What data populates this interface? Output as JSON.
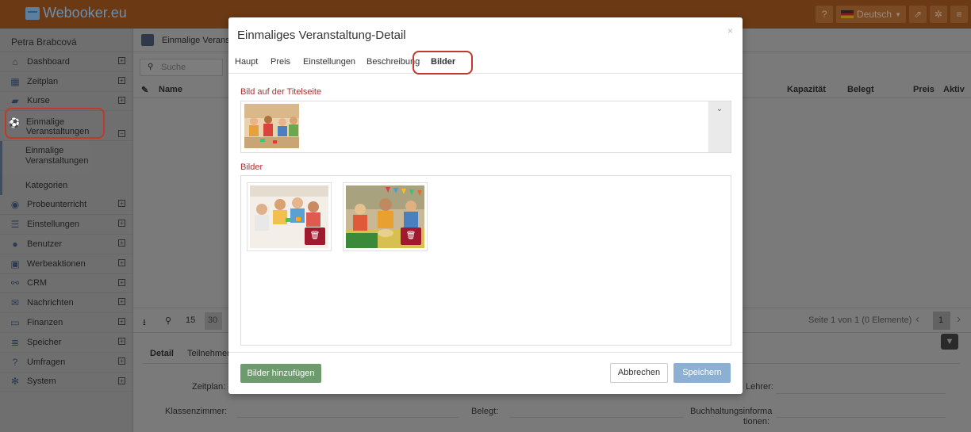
{
  "app": {
    "logo_text": "Webooker.eu"
  },
  "topbar": {
    "help_icon": "question-icon",
    "language": "Deutsch",
    "external_icon": "external-link-icon",
    "settings_icon": "gear-icon",
    "menu_icon": "hamburger-icon"
  },
  "sidebar": {
    "user": "Petra Brabcová",
    "items": [
      {
        "label": "Dashboard",
        "icon": "home-icon"
      },
      {
        "label": "Zeitplan",
        "icon": "calendar-icon"
      },
      {
        "label": "Kurse",
        "icon": "book-icon"
      },
      {
        "label": "Einmalige Veranstaltungen",
        "icon": "soccer-icon"
      },
      {
        "label": "Probeunterricht",
        "icon": "eye-slash-icon"
      },
      {
        "label": "Einstellungen",
        "icon": "sliders-icon"
      },
      {
        "label": "Benutzer",
        "icon": "users-icon"
      },
      {
        "label": "Werbeaktionen",
        "icon": "gift-icon"
      },
      {
        "label": "CRM",
        "icon": "handshake-icon"
      },
      {
        "label": "Nachrichten",
        "icon": "envelope-icon"
      },
      {
        "label": "Finanzen",
        "icon": "money-icon"
      },
      {
        "label": "Speicher",
        "icon": "database-icon"
      },
      {
        "label": "Umfragen",
        "icon": "question-icon"
      },
      {
        "label": "System",
        "icon": "cogs-icon"
      }
    ],
    "subitems": [
      "Einmalige Veranstaltungen",
      "Kategorien"
    ]
  },
  "main": {
    "breadcrumb": "Einmalige Veranst",
    "search_placeholder": "Suche",
    "columns": {
      "name": "Name",
      "capacity": "Kapazität",
      "booked": "Belegt",
      "price": "Preis",
      "active": "Aktiv"
    },
    "pager": {
      "size15": "15",
      "size30": "30",
      "info": "Seite 1 von 1 (0 Elemente)",
      "page": "1"
    },
    "detail_tabs": [
      "Detail",
      "Teilnehmer"
    ],
    "fields": {
      "zeitplan": "Zeitplan:",
      "klassenzimmer": "Klassenzimmer:",
      "belegt": "Belegt:",
      "lehrer": "Lehrer:",
      "buchhaltung_1": "Buchhaltungsinforma",
      "buchhaltung_2": "tionen:"
    }
  },
  "modal": {
    "title": "Einmaliges Veranstaltung-Detail",
    "close": "×",
    "tabs": [
      "Haupt",
      "Preis",
      "Einstellungen",
      "Beschreibung",
      "Bilder"
    ],
    "active_tab": "Bilder",
    "cover_label": "Bild auf der Titelseite",
    "gallery_label": "Bilder",
    "add_button": "Bilder hinzufügen",
    "cancel_button": "Abbrechen",
    "save_button": "Speichern"
  },
  "colors": {
    "accent_red": "#c0392b",
    "label_red": "#a33333",
    "add_green": "#6d9b6d",
    "save_blue": "#8cb0d4",
    "delete_red": "#a0192e"
  }
}
